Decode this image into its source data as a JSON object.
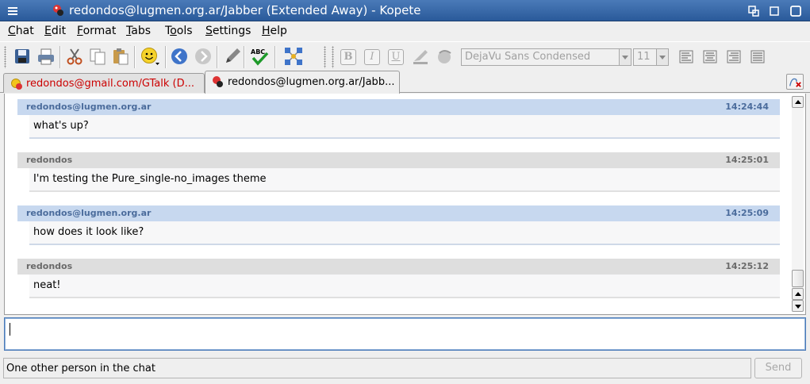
{
  "window": {
    "title": "redondos@lugmen.org.ar/Jabber (Extended Away) - Kopete"
  },
  "menu": [
    {
      "prefix": "",
      "key": "C",
      "rest": "hat"
    },
    {
      "prefix": "",
      "key": "E",
      "rest": "dit"
    },
    {
      "prefix": "",
      "key": "F",
      "rest": "ormat"
    },
    {
      "prefix": "",
      "key": "T",
      "rest": "abs"
    },
    {
      "prefix": "T",
      "key": "o",
      "rest": "ols"
    },
    {
      "prefix": "",
      "key": "S",
      "rest": "ettings"
    },
    {
      "prefix": "",
      "key": "H",
      "rest": "elp"
    }
  ],
  "toolbar": {
    "font_family": "DejaVu Sans Condensed",
    "font_size": "11",
    "bold_label": "B",
    "italic_label": "I",
    "underline_label": "U",
    "icons": [
      "save-icon",
      "print-icon",
      "cut-icon",
      "copy-icon",
      "paste-icon",
      "smiley-icon",
      "back-icon",
      "forward-icon",
      "pen-icon",
      "spellcheck-icon",
      "network-icon"
    ]
  },
  "tabs": [
    {
      "label": "redondos@gmail.com/GTalk (D...",
      "color": "#cc0000",
      "active": false
    },
    {
      "label": "redondos@lugmen.org.ar/Jabb...",
      "color": "#000000",
      "active": true
    }
  ],
  "messages": [
    {
      "sender": "redondos@lugmen.org.ar",
      "time": "14:24:44",
      "text": "what's up?",
      "direction": "in"
    },
    {
      "sender": "redondos",
      "time": "14:25:01",
      "text": "I'm testing the Pure_single-no_images theme",
      "direction": "out"
    },
    {
      "sender": "redondos@lugmen.org.ar",
      "time": "14:25:09",
      "text": "how does it look like?",
      "direction": "in"
    },
    {
      "sender": "redondos",
      "time": "14:25:12",
      "text": "neat!",
      "direction": "out"
    }
  ],
  "input": {
    "value": ""
  },
  "status": {
    "text": "One other person in the chat"
  },
  "send": {
    "label": "Send"
  },
  "colors": {
    "titlebar": "#2a5a9a",
    "incoming_header": "#c7d8ef",
    "outgoing_header": "#dedede"
  }
}
